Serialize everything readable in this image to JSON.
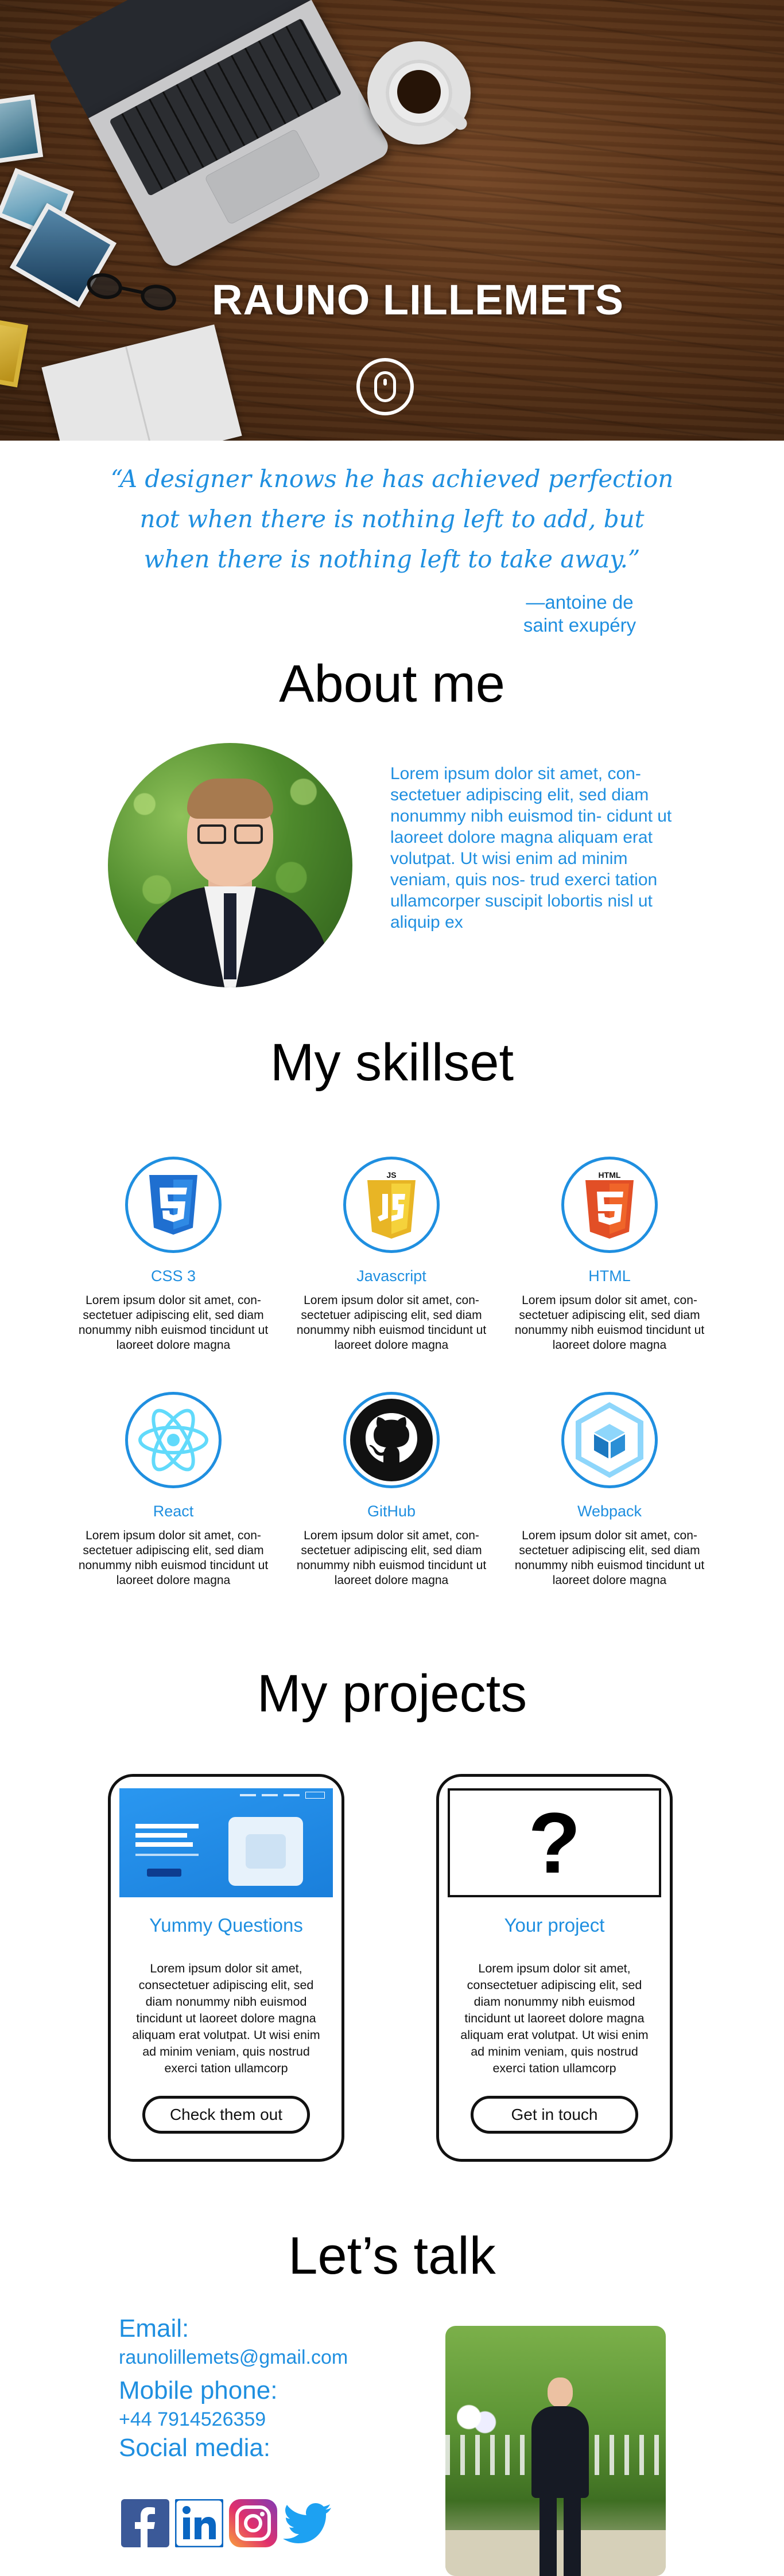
{
  "hero": {
    "title": "RAUNO LILLEMETS",
    "scroll_icon": "mouse-icon"
  },
  "quote": {
    "text": "“A designer knows he has achieved perfection not when there is nothing left to add, but when there is nothing left to take away.”",
    "author_line1": "—antoine de",
    "author_line2": "saint exupéry"
  },
  "about": {
    "title": "About me",
    "text": "Lorem ipsum dolor sit amet, con- sectetuer adipiscing elit, sed diam nonummy nibh euismod tin- cidunt ut laoreet dolore magna aliquam erat volutpat. Ut wisi enim ad minim veniam, quis nos- trud exerci tation ullamcorper suscipit lobortis nisl ut aliquip ex"
  },
  "skills": {
    "title": "My skillset",
    "items": [
      {
        "name": "CSS 3",
        "icon": "css3-icon",
        "desc": "Lorem ipsum dolor sit amet, con- sectetuer adipiscing elit, sed diam nonummy nibh euismod tincidunt ut laoreet dolore magna"
      },
      {
        "name": "Javascript",
        "icon": "javascript-icon",
        "desc": "Lorem ipsum dolor sit amet, con- sectetuer adipiscing elit, sed diam nonummy nibh euismod tincidunt ut laoreet dolore magna"
      },
      {
        "name": "HTML",
        "icon": "html5-icon",
        "desc": "Lorem ipsum dolor sit amet, con- sectetuer adipiscing elit, sed diam nonummy nibh euismod tincidunt ut laoreet dolore magna"
      },
      {
        "name": "React",
        "icon": "react-icon",
        "desc": "Lorem ipsum dolor sit amet, con- sectetuer adipiscing elit, sed diam nonummy nibh euismod tincidunt ut laoreet dolore magna"
      },
      {
        "name": "GitHub",
        "icon": "github-icon",
        "desc": "Lorem ipsum dolor sit amet, con- sectetuer adipiscing elit, sed diam nonummy nibh euismod tincidunt ut laoreet dolore magna"
      },
      {
        "name": "Webpack",
        "icon": "webpack-icon",
        "desc": "Lorem ipsum dolor sit amet, con- sectetuer adipiscing elit, sed diam nonummy nibh euismod tincidunt ut laoreet dolore magna"
      }
    ],
    "badge_js": "JS",
    "badge_html": "HTML"
  },
  "projects": {
    "title": "My projects",
    "items": [
      {
        "title": "Yummy Questions",
        "desc": "Lorem ipsum dolor sit amet, consectetuer adipiscing elit, sed diam nonummy nibh euismod tincidunt ut laoreet dolore magna aliquam erat volutpat. Ut wisi enim ad minim veniam, quis nostrud exerci tation ullamcorp",
        "button": "Check them out"
      },
      {
        "title": "Your project",
        "desc": "Lorem ipsum dolor sit amet, consectetuer adipiscing elit, sed diam nonummy nibh euismod tincidunt ut laoreet dolore magna aliquam erat volutpat. Ut wisi enim ad minim veniam, quis nostrud exerci tation ullamcorp",
        "button": "Get in touch",
        "placeholder": "?"
      }
    ]
  },
  "contact": {
    "title": "Let’s talk",
    "email_label": "Email:",
    "email": "raunolillemets@gmail.com",
    "phone_label": "Mobile phone:",
    "phone": "+44 7914526359",
    "social_label": "Social media:",
    "socials": [
      "facebook-icon",
      "linkedin-icon",
      "instagram-icon",
      "twitter-icon"
    ]
  },
  "colors": {
    "accent": "#1f8fe0",
    "text": "#000000",
    "background": "#ffffff"
  }
}
